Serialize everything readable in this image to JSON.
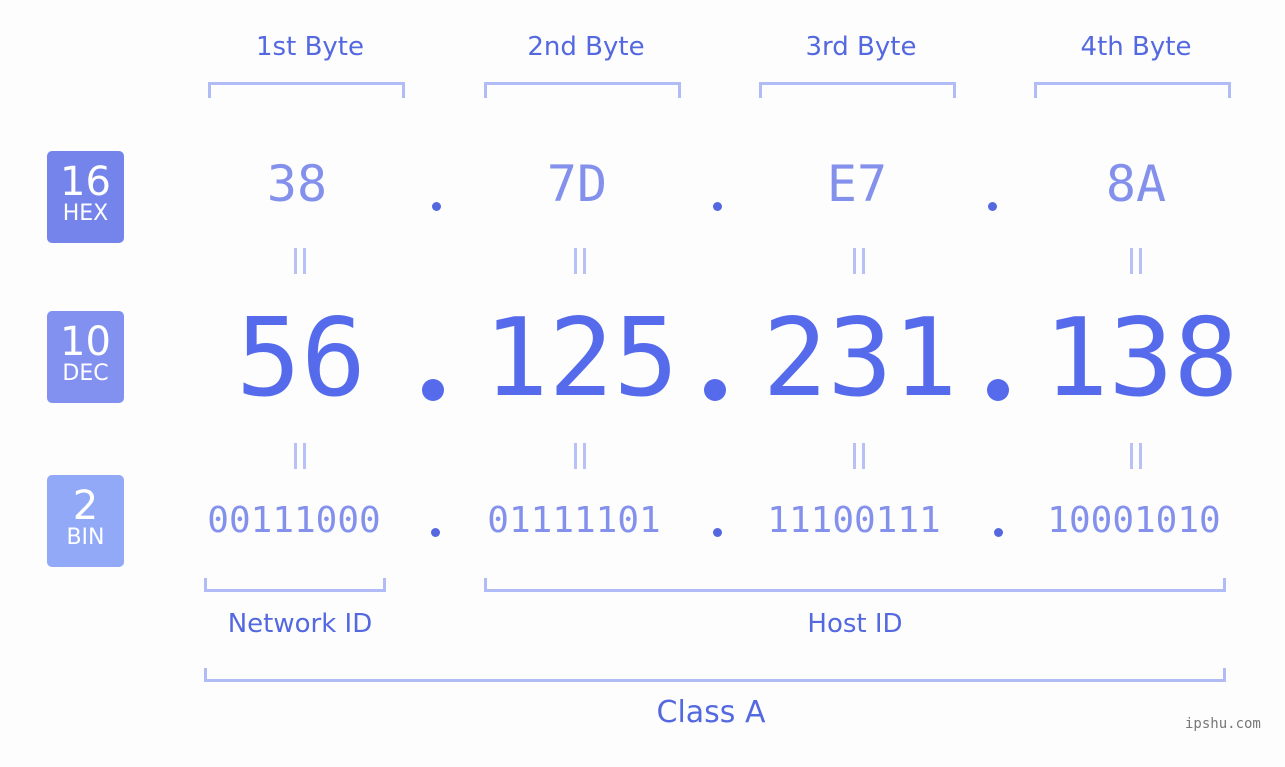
{
  "ip_address": "56.125.231.138",
  "colors": {
    "accent": "#5468e0",
    "hex_badge": "#7584ea",
    "dec_badge": "#8291f0",
    "bin_badge": "#91a9f7",
    "bracket": "#b1bbf6",
    "value_light": "#8491ec",
    "value_strong": "#556bec"
  },
  "byte_headers": [
    "1st Byte",
    "2nd Byte",
    "3rd Byte",
    "4th Byte"
  ],
  "badges": {
    "hex": {
      "number": "16",
      "label": "HEX"
    },
    "dec": {
      "number": "10",
      "label": "DEC"
    },
    "bin": {
      "number": "2",
      "label": "BIN"
    }
  },
  "hex_values": [
    "38",
    "7D",
    "E7",
    "8A"
  ],
  "dec_values": [
    "56",
    "125",
    "231",
    "138"
  ],
  "bin_values": [
    "00111000",
    "01111101",
    "11100111",
    "10001010"
  ],
  "separator": ".",
  "equals_symbol": "=",
  "network_id_label": "Network ID",
  "host_id_label": "Host ID",
  "class_label": "Class A",
  "watermark": "ipshu.com"
}
